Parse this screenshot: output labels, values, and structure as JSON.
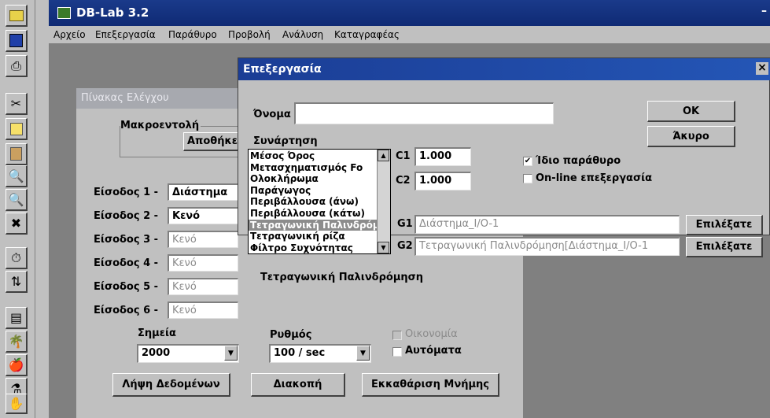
{
  "app": {
    "title": "DB-Lab 3.2"
  },
  "toolbar": {
    "icons": [
      "folder-icon",
      "save-icon",
      "print-icon",
      "cut-icon",
      "copy-icon",
      "paste-icon",
      "zoom-in-icon",
      "zoom-out-icon",
      "zoom-fit-icon",
      "timer-icon",
      "delete-icon",
      "window-icon",
      "tree-icon",
      "apple-icon",
      "flask-icon",
      "stop-icon"
    ]
  },
  "menu": [
    "Αρχείο",
    "Επεξεργασία",
    "Παράθυρο",
    "Προβολή",
    "Ανάλυση",
    "Καταγραφέας"
  ],
  "control": {
    "title": "Πίνακας Ελέγχου",
    "macro_label": "Μακροεντολή",
    "store_button": "Αποθήκευση",
    "inputs": [
      {
        "label": "Είσοδος 1 -",
        "value": "Διάστημα"
      },
      {
        "label": "Είσοδος 2 -",
        "value": "Κενό"
      },
      {
        "label": "Είσοδος 3 -",
        "value": "Κενό"
      },
      {
        "label": "Είσοδος 4 -",
        "value": "Κενό"
      },
      {
        "label": "Είσοδος 5 -",
        "value": "Κενό"
      },
      {
        "label": "Είσοδος 6 -",
        "value": "Κενό"
      }
    ],
    "points_label": "Σημεία",
    "points_value": "2000",
    "rate_label": "Ρυθμός",
    "rate_value": "100 / sec",
    "economy_label": "Οικονομία",
    "auto_label": "Αυτόματα",
    "acquire_button": "Λήψη Δεδομένων",
    "stop_button": "Διακοπή",
    "clear_button": "Εκκαθάριση Μνήμης"
  },
  "dialog": {
    "title": "Επεξεργασία",
    "close": "×",
    "name_label": "Όνομα",
    "name_value": "",
    "function_label": "Συνάρτηση",
    "functions": [
      "Μέσος Όρος",
      "Μετασχηματισμός Fo",
      "Ολοκλήρωμα",
      "Παράγωγος",
      "Περιβάλλουσα (άνω)",
      "Περιβάλλουσα (κάτω)",
      "Τετραγωνική Παλινδρόμηση",
      "Τετραγωνική ρίζα",
      "Φίλτρο Συχνότητας"
    ],
    "selected_function": 6,
    "c1_label": "C1",
    "c1_value": "1.000",
    "c2_label": "C2",
    "c2_value": "1.000",
    "same_window_label": "Ίδιο παράθυρο",
    "same_window_checked": true,
    "online_label": "On-line επεξεργασία",
    "online_checked": false,
    "g1_label": "G1",
    "g1_value": "Διάστημα_I/O-1",
    "g2_label": "G2",
    "g2_value": "Τετραγωνική Παλινδρόμηση[Διάστημα_I/O-1",
    "select_button": "Επιλέξατε",
    "ok_button": "OK",
    "cancel_button": "Άκυρο",
    "description": "Τετραγωνική Παλινδρόμηση"
  }
}
